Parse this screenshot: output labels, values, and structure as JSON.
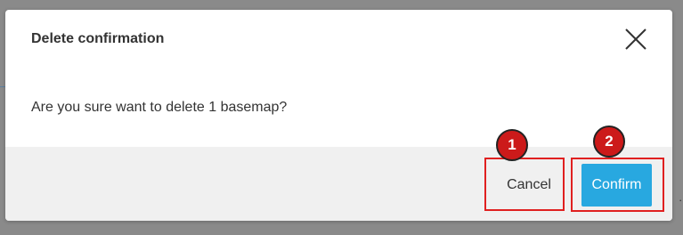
{
  "dialog": {
    "title": "Delete confirmation",
    "message": "Are you sure want to delete 1 basemap?",
    "close_icon": "close-icon",
    "cancel_label": "Cancel",
    "confirm_label": "Confirm"
  },
  "background": {
    "partial_text": "."
  },
  "annotations": [
    {
      "number": "1"
    },
    {
      "number": "2"
    }
  ],
  "colors": {
    "confirm_button": "#28a8e0",
    "footer": "#f0f0f0",
    "highlight": "#e02020",
    "badge": "#cc1a1a"
  }
}
